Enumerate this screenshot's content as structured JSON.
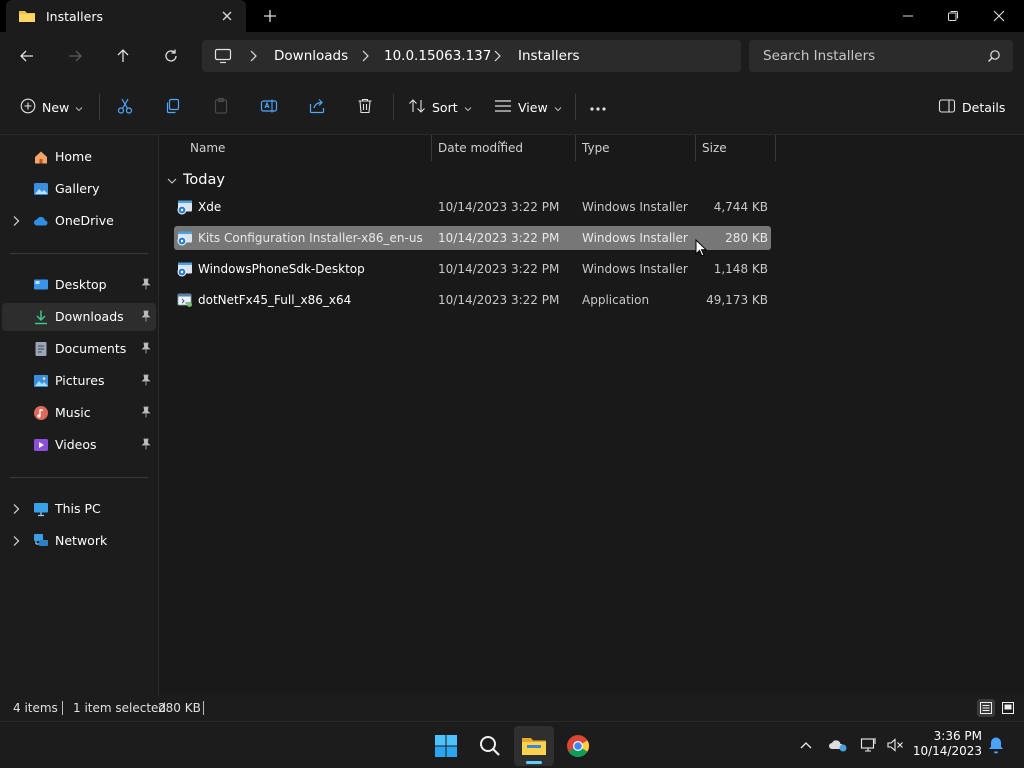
{
  "window": {
    "tab_title": "Installers",
    "tab_close": "×",
    "new_tab": "+"
  },
  "address": {
    "crumbs": [
      "Downloads",
      "10.0.15063.137",
      "Installers"
    ],
    "search_placeholder": "Search Installers"
  },
  "toolbar": {
    "new_label": "New",
    "sort_label": "Sort",
    "view_label": "View",
    "more_label": "···",
    "details_label": "Details"
  },
  "sidebar": {
    "items": [
      {
        "label": "Home",
        "icon": "home-icon"
      },
      {
        "label": "Gallery",
        "icon": "gallery-icon"
      },
      {
        "label": "OneDrive",
        "icon": "cloud-icon"
      },
      {
        "label": "Desktop",
        "icon": "desktop-icon"
      },
      {
        "label": "Downloads",
        "icon": "download-icon"
      },
      {
        "label": "Documents",
        "icon": "document-icon"
      },
      {
        "label": "Pictures",
        "icon": "picture-icon"
      },
      {
        "label": "Music",
        "icon": "music-icon"
      },
      {
        "label": "Videos",
        "icon": "video-icon"
      },
      {
        "label": "This PC",
        "icon": "computer-icon"
      },
      {
        "label": "Network",
        "icon": "network-icon"
      }
    ]
  },
  "columns": {
    "name": "Name",
    "date": "Date modified",
    "type": "Type",
    "size": "Size"
  },
  "group_label": "Today",
  "files": [
    {
      "name": "Xde",
      "date": "10/14/2023 3:22 PM",
      "type": "Windows Installer ...",
      "size": "4,744 KB"
    },
    {
      "name": "Kits Configuration Installer-x86_en-us",
      "date": "10/14/2023 3:22 PM",
      "type": "Windows Installer ...",
      "size": "280 KB"
    },
    {
      "name": "WindowsPhoneSdk-Desktop",
      "date": "10/14/2023 3:22 PM",
      "type": "Windows Installer ...",
      "size": "1,148 KB"
    },
    {
      "name": "dotNetFx45_Full_x86_x64",
      "date": "10/14/2023 3:22 PM",
      "type": "Application",
      "size": "49,173 KB"
    }
  ],
  "status": {
    "items": "4 items",
    "selected": "1 item selected",
    "selected_size": "280 KB"
  },
  "clock": {
    "time": "3:36 PM",
    "date": "10/14/2023"
  },
  "colors": {
    "accent": "#60cdff",
    "selection": "#777777"
  }
}
